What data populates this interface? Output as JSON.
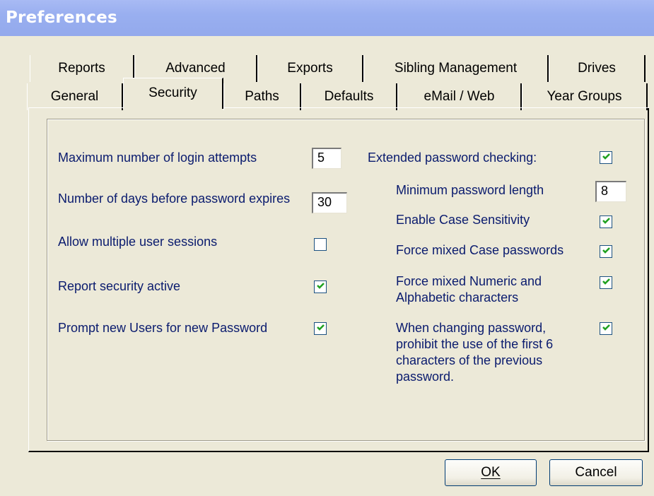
{
  "window": {
    "title": "Preferences"
  },
  "tabs": {
    "row1": [
      "Reports",
      "Advanced",
      "Exports",
      "Sibling Management",
      "Drives"
    ],
    "row2": [
      "General",
      "Security",
      "Paths",
      "Defaults",
      "eMail / Web",
      "Year Groups"
    ],
    "active": "Security"
  },
  "left": {
    "max_login_label": "Maximum number of login attempts",
    "max_login_value": "5",
    "days_expire_label": "Number of days before password expires",
    "days_expire_value": "30",
    "multi_sessions_label": "Allow multiple user sessions",
    "multi_sessions_checked": false,
    "report_security_label": "Report security active",
    "report_security_checked": true,
    "prompt_new_label": "Prompt new Users for new Password",
    "prompt_new_checked": true
  },
  "right": {
    "extended_label": "Extended password checking:",
    "extended_checked": true,
    "min_length_label": "Minimum password length",
    "min_length_value": "8",
    "case_sensitivity_label": "Enable Case Sensitivity",
    "case_sensitivity_checked": true,
    "mixed_case_label": "Force mixed Case passwords",
    "mixed_case_checked": true,
    "mixed_numeric_label_1": "Force mixed Numeric and",
    "mixed_numeric_label_2": "Alphabetic characters",
    "mixed_numeric_checked": true,
    "prohibit_label_1": "When changing password,",
    "prohibit_label_2": "prohibit the use of the first 6",
    "prohibit_label_3": "characters of the previous",
    "prohibit_label_4": "password.",
    "prohibit_checked": true
  },
  "buttons": {
    "ok_label": "OK",
    "cancel_label": "Cancel"
  },
  "colors": {
    "label_text": "#0a1b6e",
    "check_green": "#21a121",
    "title_bar": "#99aff0"
  }
}
